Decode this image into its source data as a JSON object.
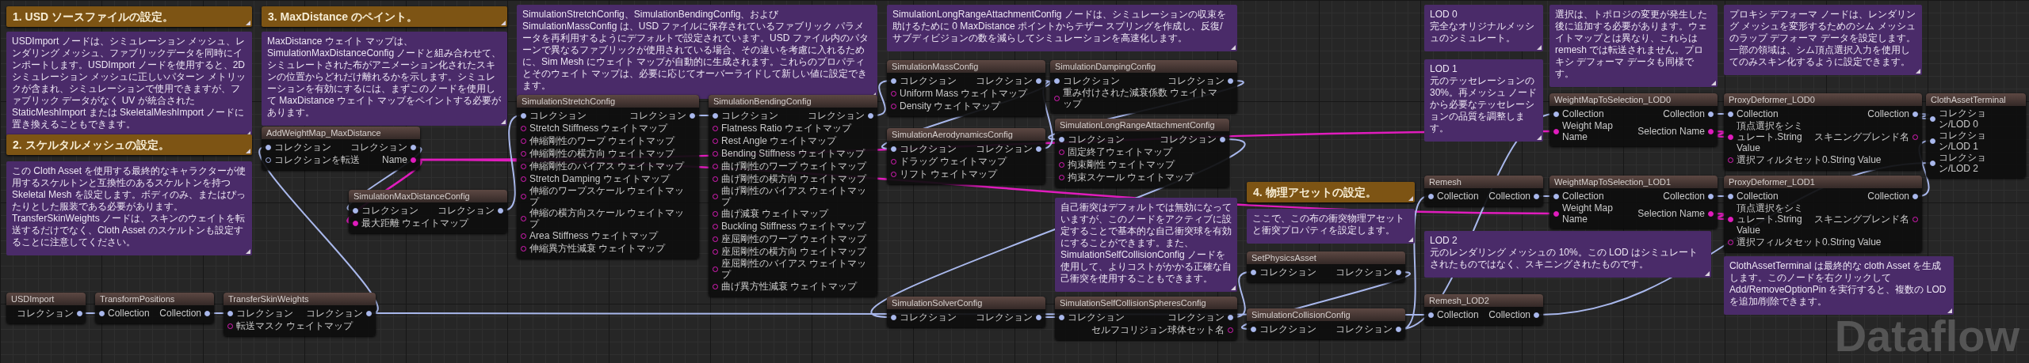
{
  "headings": [
    {
      "text": "1. USD ソースファイルの設定。"
    },
    {
      "text": "2. スケルタルメッシュの設定。"
    },
    {
      "text": "3. MaxDistance のペイント。"
    },
    {
      "text": "4. 物理アセットの設定。"
    }
  ],
  "comments": [
    {
      "text": "USDImport ノードは、シミュレーション メッシュ、レンダリング メッシュ、ファブリックデータを同時にインポートします。USDImport ノードを使用すると、2D シミュレーション メッシュに正しいパターン メトリックが含まれ、シミュレーションで使用できますが、ファブリック データがなく UV が統合された StaticMeshImport または SkeletalMeshImport ノードに置き換えることもできます。"
    },
    {
      "text": "この Cloth Asset を使用する最終的なキャラクターが使用するスケルトンと互換性のあるスケルトンを持つ Skeletal Mesh を設定します。ボディのみ、またはぴったりとした服装である必要があります。TransferSkinWeights ノードは、スキンのウェイトを転送するだけでなく、Cloth Asset のスケルトンも設定することに注意してください。"
    },
    {
      "text": "MaxDistance ウェイト マップは、SimulationMaxDistanceConfig ノードと組み合わせて、シミュレートされた布がアニメーション化されたスキンの位置からどれだけ離れるかを示します。シミュレーションを有効にするには、まずこのノードを使用して MaxDistance ウェイト マップをペイントする必要があります。"
    },
    {
      "text": "SimulationStretchConfig、SimulationBendingConfig、および SimulationMassConfig は、USD ファイルに保存されているファブリック パラメータを再利用するようにデフォルトで設定されています。USD ファイル内のパターンで異なるファブリックが使用されている場合、その違いを考慮に入れるために、Sim Mesh にウェイト マップが自動的に生成されます。これらのプロパティとそのウェイト マップは、必要に応じてオーバーライドして新しい値に設定できます。"
    },
    {
      "text": "SimulationLongRangeAttachmentConfig ノードは、シミュレーションの収束を助けるために 0 MaxDistance ポイントからテザー スプリングを作成し、反復/サブディビジョンの数を減らしてシミュレーションを高速化します。"
    },
    {
      "text": "自己衝突はデフォルトでは無効になっていますが、このノードをアクティブに設定することで基本的な自己衝突球を有効にすることができます。また、SimulationSelfCollisionConfig ノードを使用して、よりコストがかかる正確な自己衝突を使用することもできます。"
    },
    {
      "text": "ここで、この布の衝突物理アセットと衝突プロパティを設定します。"
    },
    {
      "title": "LOD 0",
      "text": "完全なオリジナルメッシュのシミュレート。"
    },
    {
      "text": "選択は、トポロジの変更が発生した後に追加する必要があります。ウェイトマップとは異なり、これらは remesh では転送されません。プロキシ デフォーマ データも同様です。"
    },
    {
      "text": "プロキシ デフォーマ ノードは、レンダリング メッシュを変形するためのシム メッシュのラップ デフォーマ データを設定します。一部の領域は、シム頂点選択入力を使用してのみスキン化するように設定できます。"
    },
    {
      "title": "LOD 1",
      "text": "元のテッセレーションの 30%。再メッシュ ノードから必要なテッセレーションの品質を調整します。"
    },
    {
      "text": "ClothAssetTerminal は最終的な cloth Asset を生成します。このノードを右クリックして Add/RemoveOptionPin を実行すると、複数の LOD を追加/削除できます。"
    },
    {
      "title": "LOD 2",
      "text": "元のレンダリング メッシュの 10%。この LOD はシミュレートされたものではなく、スキニングされたものです。"
    }
  ],
  "nodes": [
    {
      "title": "USDImport",
      "outputs": [
        {
          "label": "コレクション",
          "kind": "collection",
          "connected": true
        }
      ]
    },
    {
      "title": "TransformPositions",
      "inputs": [
        {
          "label": "Collection",
          "kind": "collection",
          "connected": true
        }
      ],
      "outputs": [
        {
          "label": "Collection",
          "kind": "collection",
          "connected": true
        }
      ]
    },
    {
      "title": "TransferSkinWeights",
      "inputs": [
        {
          "label": "コレクション",
          "kind": "collection",
          "connected": true
        },
        {
          "label": "転送マスク ウェイトマップ",
          "kind": "map",
          "connected": false
        }
      ],
      "outputs": [
        {
          "label": "コレクション",
          "kind": "collection",
          "connected": true
        }
      ]
    },
    {
      "title": "AddWeightMap_MaxDistance",
      "inputs": [
        {
          "label": "コレクション",
          "kind": "collection",
          "connected": true
        },
        {
          "label": "コレクションを転送",
          "kind": "collection",
          "connected": false
        }
      ],
      "outputs": [
        {
          "label": "コレクション",
          "kind": "collection",
          "connected": true
        },
        {
          "label": "Name",
          "kind": "map",
          "connected": true
        }
      ]
    },
    {
      "title": "SimulationMaxDistanceConfig",
      "inputs": [
        {
          "label": "コレクション",
          "kind": "collection",
          "connected": true
        },
        {
          "label": "最大距離 ウェイトマップ",
          "kind": "map",
          "connected": true
        }
      ],
      "outputs": [
        {
          "label": "コレクション",
          "kind": "collection",
          "connected": true
        }
      ]
    },
    {
      "title": "SimulationStretchConfig",
      "inputs": [
        {
          "label": "コレクション",
          "kind": "collection",
          "connected": true
        },
        {
          "label": "Stretch Stiffness ウェイトマップ",
          "kind": "map",
          "connected": false
        },
        {
          "label": "伸縮剛性のワープ ウェイトマップ",
          "kind": "map",
          "connected": false
        },
        {
          "label": "伸縮剛性の横方向 ウェイトマップ",
          "kind": "map",
          "connected": false
        },
        {
          "label": "伸縮剛性のバイアス ウェイトマップ",
          "kind": "map",
          "connected": false
        },
        {
          "label": "Stretch Damping ウェイトマップ",
          "kind": "map",
          "connected": false
        },
        {
          "label": "伸縮のワープスケール ウェイトマップ",
          "kind": "map",
          "connected": false
        },
        {
          "label": "伸縮の横方向スケール ウェイトマップ",
          "kind": "map",
          "connected": false
        },
        {
          "label": "Area Stiffness ウェイトマップ",
          "kind": "map",
          "connected": false
        },
        {
          "label": "伸縮異方性減衰 ウェイトマップ",
          "kind": "map",
          "connected": false
        }
      ],
      "outputs": [
        {
          "label": "コレクション",
          "kind": "collection",
          "connected": true
        }
      ]
    },
    {
      "title": "SimulationBendingConfig",
      "inputs": [
        {
          "label": "コレクション",
          "kind": "collection",
          "connected": true
        },
        {
          "label": "Flatness Ratio ウェイトマップ",
          "kind": "map",
          "connected": false
        },
        {
          "label": "Rest Angle ウェイトマップ",
          "kind": "map",
          "connected": false
        },
        {
          "label": "Bending Stiffness ウェイトマップ",
          "kind": "map",
          "connected": false
        },
        {
          "label": "曲げ剛性のワープ ウェイトマップ",
          "kind": "map",
          "connected": false
        },
        {
          "label": "曲げ剛性の横方向 ウェイトマップ",
          "kind": "map",
          "connected": false
        },
        {
          "label": "曲げ剛性のバイアス ウェイトマップ",
          "kind": "map",
          "connected": false
        },
        {
          "label": "曲げ減衰 ウェイトマップ",
          "kind": "map",
          "connected": false
        },
        {
          "label": "Buckling Stiffness ウェイトマップ",
          "kind": "map",
          "connected": false
        },
        {
          "label": "座屈剛性のワープ ウェイトマップ",
          "kind": "map",
          "connected": false
        },
        {
          "label": "座屈剛性の横方向 ウェイトマップ",
          "kind": "map",
          "connected": false
        },
        {
          "label": "座屈剛性のバイアス ウェイトマップ",
          "kind": "map",
          "connected": false
        },
        {
          "label": "曲げ異方性減衰 ウェイトマップ",
          "kind": "map",
          "connected": false
        }
      ],
      "outputs": [
        {
          "label": "コレクション",
          "kind": "collection",
          "connected": true
        }
      ]
    },
    {
      "title": "SimulationMassConfig",
      "inputs": [
        {
          "label": "コレクション",
          "kind": "collection",
          "connected": true
        },
        {
          "label": "Uniform Mass ウェイトマップ",
          "kind": "map",
          "connected": false
        },
        {
          "label": "Density ウェイトマップ",
          "kind": "map",
          "connected": false
        }
      ],
      "outputs": [
        {
          "label": "コレクション",
          "kind": "collection",
          "connected": true
        }
      ]
    },
    {
      "title": "SimulationAerodynamicsConfig",
      "inputs": [
        {
          "label": "コレクション",
          "kind": "collection",
          "connected": true
        },
        {
          "label": "ドラッグ ウェイトマップ",
          "kind": "map",
          "connected": false
        },
        {
          "label": "リフト ウェイトマップ",
          "kind": "map",
          "connected": false
        }
      ],
      "outputs": [
        {
          "label": "コレクション",
          "kind": "collection",
          "connected": true
        }
      ]
    },
    {
      "title": "SimulationDampingConfig",
      "inputs": [
        {
          "label": "コレクション",
          "kind": "collection",
          "connected": true
        },
        {
          "label": "重み付けされた減衰係数 ウェイトマップ",
          "kind": "map",
          "connected": false
        }
      ],
      "outputs": [
        {
          "label": "コレクション",
          "kind": "collection",
          "connected": true
        }
      ]
    },
    {
      "title": "SimulationLongRangeAttachmentConfig",
      "inputs": [
        {
          "label": "コレクション",
          "kind": "collection",
          "connected": true
        },
        {
          "label": "固定終了ウェイトマップ",
          "kind": "map",
          "connected": false
        },
        {
          "label": "拘束剛性 ウェイトマップ",
          "kind": "map",
          "connected": false
        },
        {
          "label": "拘束スケール ウェイトマップ",
          "kind": "map",
          "connected": false
        }
      ],
      "outputs": [
        {
          "label": "コレクション",
          "kind": "collection",
          "connected": true
        }
      ]
    },
    {
      "title": "SimulationSolverConfig",
      "inputs": [
        {
          "label": "コレクション",
          "kind": "collection",
          "connected": true
        }
      ],
      "outputs": [
        {
          "label": "コレクション",
          "kind": "collection",
          "connected": true
        }
      ]
    },
    {
      "title": "SimulationSelfCollisionSpheresConfig",
      "inputs": [
        {
          "label": "コレクション",
          "kind": "collection",
          "connected": true
        }
      ],
      "outputs": [
        {
          "label": "コレクション",
          "kind": "collection",
          "connected": true
        },
        {
          "label": "セルフコリジョン球体セット名",
          "kind": "map",
          "connected": false
        }
      ]
    },
    {
      "title": "SetPhysicsAsset",
      "inputs": [
        {
          "label": "コレクション",
          "kind": "collection",
          "connected": true
        }
      ],
      "outputs": [
        {
          "label": "コレクション",
          "kind": "collection",
          "connected": true
        }
      ]
    },
    {
      "title": "SimulationCollisionConfig",
      "inputs": [
        {
          "label": "コレクション",
          "kind": "collection",
          "connected": true
        }
      ],
      "outputs": [
        {
          "label": "コレクション",
          "kind": "collection",
          "connected": true
        }
      ]
    },
    {
      "title": "WeightMapToSelection_LOD0",
      "inputs": [
        {
          "label": "Collection",
          "kind": "collection",
          "connected": true
        },
        {
          "label": "Weight Map Name",
          "kind": "map",
          "connected": true
        }
      ],
      "outputs": [
        {
          "label": "Collection",
          "kind": "collection",
          "connected": true
        },
        {
          "label": "Selection Name",
          "kind": "map",
          "connected": true
        }
      ]
    },
    {
      "title": "ProxyDeformer_LOD0",
      "inputs": [
        {
          "label": "Collection",
          "kind": "collection",
          "connected": true
        },
        {
          "label": "頂点選択をシミュレート.String Value",
          "kind": "map",
          "connected": true
        },
        {
          "label": "選択フィルタセット0.String Value",
          "kind": "map",
          "connected": false
        }
      ],
      "outputs": [
        {
          "label": "Collection",
          "kind": "collection",
          "connected": true
        },
        {
          "label": "スキニングブレンド名",
          "kind": "map",
          "connected": false
        }
      ]
    },
    {
      "title": "Remesh",
      "inputs": [
        {
          "label": "Collection",
          "kind": "collection",
          "connected": true
        }
      ],
      "outputs": [
        {
          "label": "Collection",
          "kind": "collection",
          "connected": true
        }
      ]
    },
    {
      "title": "WeightMapToSelection_LOD1",
      "inputs": [
        {
          "label": "Collection",
          "kind": "collection",
          "connected": true
        },
        {
          "label": "Weight Map Name",
          "kind": "map",
          "connected": true
        }
      ],
      "outputs": [
        {
          "label": "Collection",
          "kind": "collection",
          "connected": true
        },
        {
          "label": "Selection Name",
          "kind": "map",
          "connected": true
        }
      ]
    },
    {
      "title": "ProxyDeformer_LOD1",
      "inputs": [
        {
          "label": "Collection",
          "kind": "collection",
          "connected": true
        },
        {
          "label": "頂点選択をシミュレート.String Value",
          "kind": "map",
          "connected": true
        },
        {
          "label": "選択フィルタセット0.String Value",
          "kind": "map",
          "connected": false
        }
      ],
      "outputs": [
        {
          "label": "Collection",
          "kind": "collection",
          "connected": true
        },
        {
          "label": "スキニングブレンド名",
          "kind": "map",
          "connected": false
        }
      ]
    },
    {
      "title": "Remesh_LOD2",
      "inputs": [
        {
          "label": "Collection",
          "kind": "collection",
          "connected": true
        }
      ],
      "outputs": [
        {
          "label": "Collection",
          "kind": "collection",
          "connected": true
        }
      ]
    },
    {
      "title": "ClothAssetTerminal",
      "inputs": [
        {
          "label": "コレクション/LOD 0",
          "kind": "collection",
          "connected": true
        },
        {
          "label": "コレクション/LOD 1",
          "kind": "collection",
          "connected": true
        },
        {
          "label": "コレクション/LOD 2",
          "kind": "collection",
          "connected": true
        }
      ]
    }
  ],
  "graph_label": "Dataflow"
}
